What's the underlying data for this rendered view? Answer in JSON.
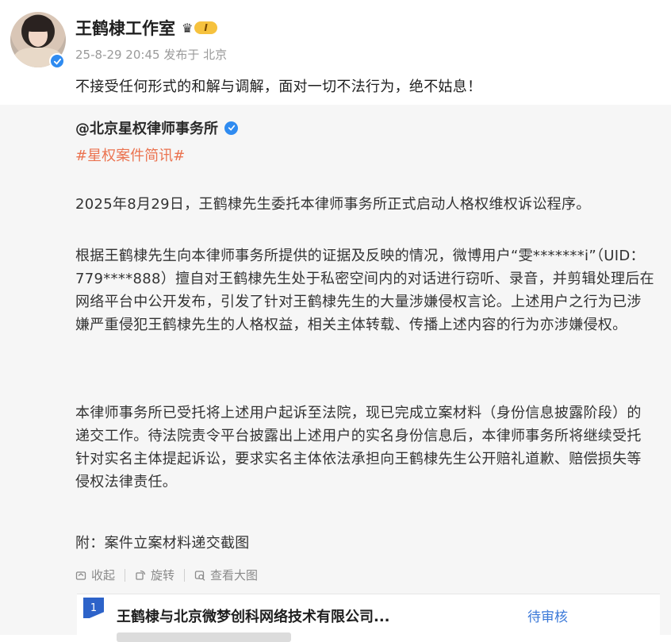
{
  "post": {
    "username": "王鹤棣工作室",
    "vip_level": "I",
    "timestamp": "25-8-29 20:45",
    "posted_from_label": "发布于",
    "location": "北京",
    "text": "不接受任何形式的和解与调解，面对一切不法行为，绝不姑息！"
  },
  "repost": {
    "author": "@北京星权律师事务所",
    "hashtag": "#星权案件简讯#",
    "paragraphs": [
      "2025年8月29日，王鹤棣先生委托本律师事务所正式启动人格权维权诉讼程序。",
      "根据王鹤棣先生向本律师事务所提供的证据及反映的情况，微博用户“雯*******i”（UID：779****888）擅自对王鹤棣先生处于私密空间内的对话进行窃听、录音，并剪辑处理后在网络平台中公开发布，引发了针对王鹤棣先生的大量涉嫌侵权言论。上述用户之行为已涉嫌严重侵犯王鹤棣先生的人格权益，相关主体转载、传播上述内容的行为亦涉嫌侵权。",
      "本律师事务所已受托将上述用户起诉至法院，现已完成立案材料（身份信息披露阶段）的递交工作。待法院责令平台披露出上述用户的实名身份信息后，本律师事务所将继续受托针对实名主体提起诉讼，要求实名主体依法承担向王鹤棣先生公开赔礼道歉、赔偿损失等侵权法律责任。",
      "附：案件立案材料递交截图"
    ],
    "actions": {
      "collapse": "收起",
      "rotate": "旋转",
      "view_large": "查看大图"
    },
    "attachment": {
      "index": "1",
      "title": "王鹤棣与北京微梦创科网络技术有限公司...",
      "status": "待审核"
    }
  },
  "colors": {
    "hashtag": "#eb7350",
    "verified": "#2f8bf0",
    "status": "#3a78d8",
    "vip": "#f6c23e"
  }
}
